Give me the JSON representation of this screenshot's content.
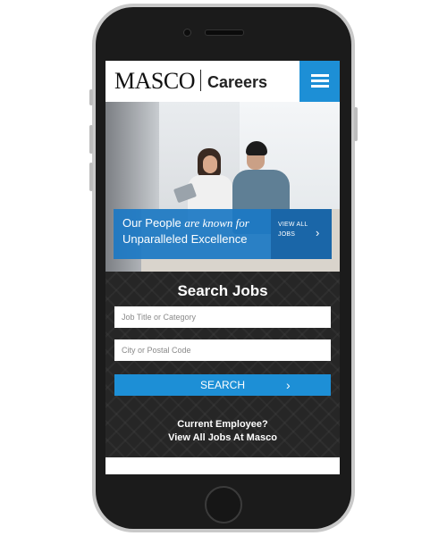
{
  "header": {
    "logo_brand": "MASCO",
    "logo_section": "Careers",
    "menu_icon": "hamburger-menu-icon",
    "accent_color": "#1d8fd6"
  },
  "hero": {
    "tagline_part1": "Our People",
    "tagline_em": "are known for",
    "tagline_part2": "Unparalleled Excellence",
    "view_all_label": "VIEW ALL JOBS",
    "chevron_icon": "chevron-right-icon",
    "banner_color": "#1b78c4"
  },
  "search": {
    "title": "Search Jobs",
    "job_placeholder": "Job Title or Category",
    "location_placeholder": "City or Postal Code",
    "button_label": "SEARCH",
    "button_icon": "chevron-right-icon"
  },
  "employee": {
    "line1": "Current Employee?",
    "line2": "View All Jobs At Masco"
  }
}
